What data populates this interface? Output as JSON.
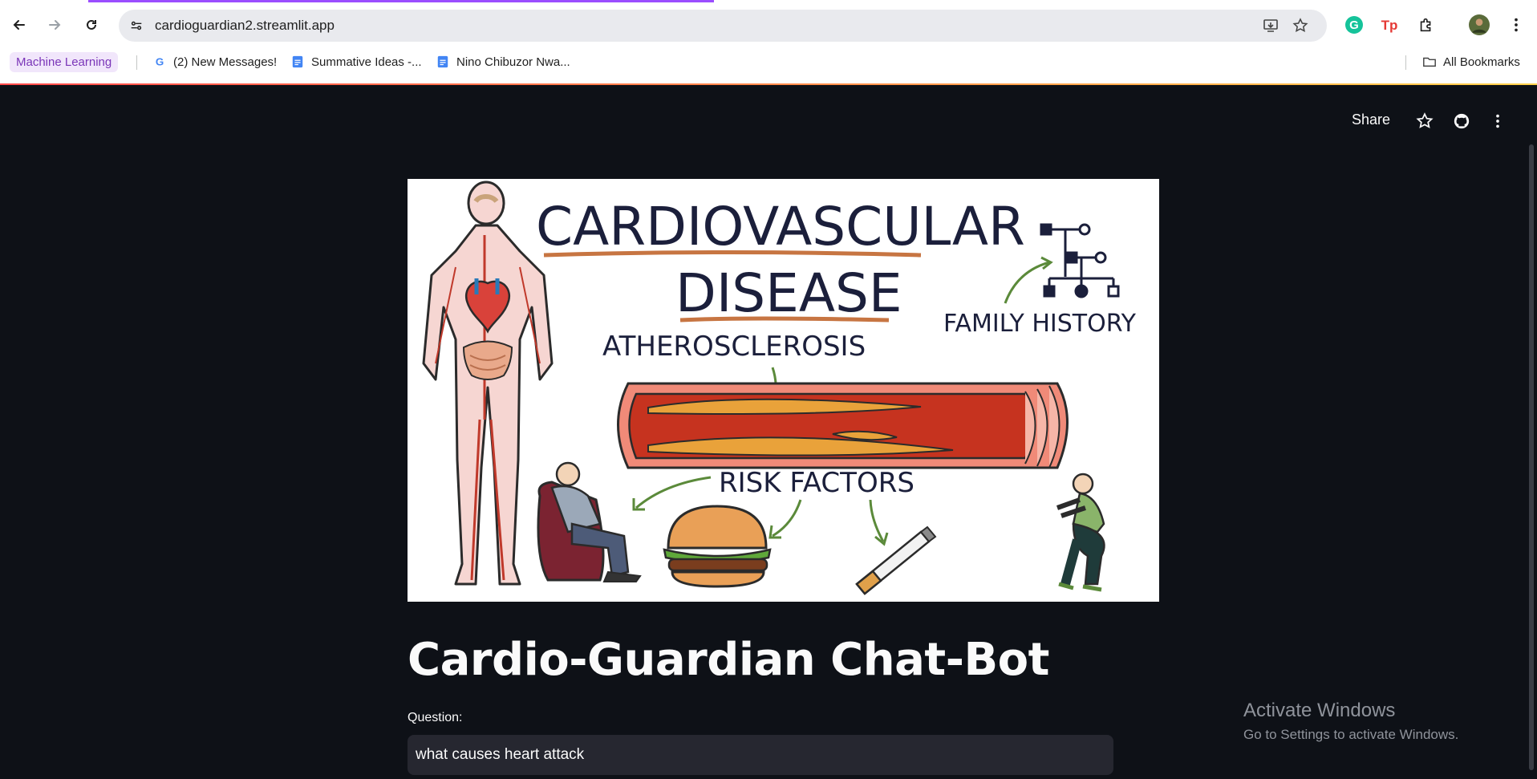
{
  "browser": {
    "url": "cardioguardian2.streamlit.app",
    "bookmarks": [
      {
        "label": "Machine Learning"
      },
      {
        "label": "(2) New Messages!"
      },
      {
        "label": "Summative Ideas -..."
      },
      {
        "label": "Nino Chibuzor Nwa..."
      }
    ],
    "all_bookmarks": "All Bookmarks"
  },
  "app": {
    "share_label": "Share",
    "hero": {
      "title_line1": "CARDIOVASCULAR",
      "title_line2": "DISEASE",
      "family_history": "FAMILY HISTORY",
      "atherosclerosis": "ATHEROSCLEROSIS",
      "risk_factors": "RISK FACTORS"
    },
    "title": "Cardio-Guardian Chat-Bot",
    "question_label": "Question:",
    "question_value": "what causes heart attack"
  },
  "os_watermark": {
    "line1": "Activate Windows",
    "line2": "Go to Settings to activate Windows."
  },
  "colors": {
    "app_bg": "#0e1117",
    "input_bg": "#262730",
    "accent": "#ff4b4b"
  }
}
